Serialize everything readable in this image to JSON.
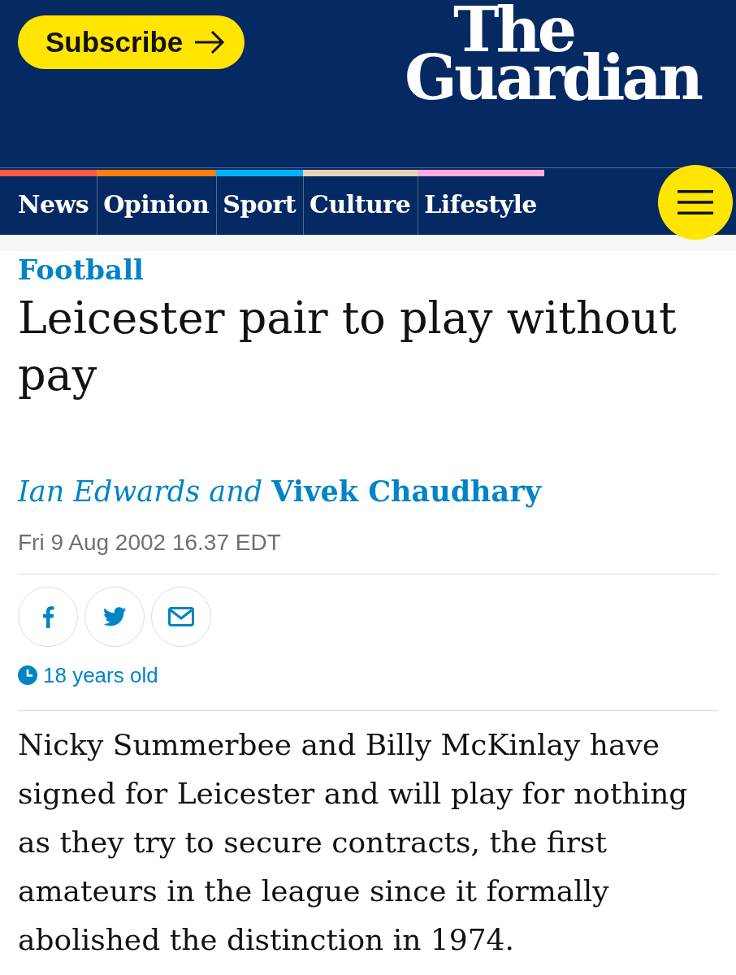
{
  "header": {
    "subscribe_button": "Subscribe",
    "logo": [
      "The",
      "Guardian"
    ]
  },
  "nav": {
    "items": [
      {
        "label": "News",
        "color": "#ff5943"
      },
      {
        "label": "Opinion",
        "color": "#ff7f0f"
      },
      {
        "label": "Sport",
        "color": "#00b2ff"
      },
      {
        "label": "Culture",
        "color": "#e7d4b9"
      },
      {
        "label": "Lifestyle",
        "color": "#ffabdb"
      }
    ]
  },
  "article": {
    "kicker": "Football",
    "headline": "Leicester pair to play without pay",
    "byline": "*Ian Edwards and* **Vivek Chaudhary**",
    "dateline": "Fri 9 Aug 2002 16.37 EDT",
    "share_buttons": [
      {
        "kind": "facebook"
      },
      {
        "kind": "twitter"
      },
      {
        "kind": "email"
      }
    ],
    "age": "18 years old",
    "body": "Nicky Summerbee and Billy McKinlay have signed for Leicester and will play for nothing as they try to secure contracts, the first amateurs in the league since it formally abolished the distinction in 1974."
  }
}
